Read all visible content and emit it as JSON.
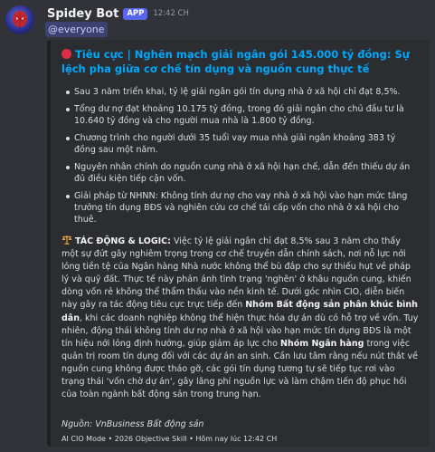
{
  "bot": {
    "name": "Spidey Bot",
    "badge": "APP",
    "timestamp": "12:42 CH",
    "mention": "@everyone"
  },
  "embed": {
    "accent_color": "#1e1f22",
    "title": "Tiêu cực | Nghẽn mạch giải ngân gói 145.000 tỷ đồng: Sự lệch pha giữa cơ chế tín dụng và nguồn cung thực tế",
    "title_icon": "red-circle-icon",
    "bullets": [
      "Sau 3 năm triển khai, tỷ lệ giải ngân gói tín dụng nhà ở xã hội chỉ đạt 8,5%.",
      "Tổng dư nợ đạt khoảng 10.175 tỷ đồng, trong đó giải ngân cho chủ đầu tư là 10.640 tỷ đồng và cho người mua nhà là 1.800 tỷ đồng.",
      "Chương trình cho người dưới 35 tuổi vay mua nhà giải ngân khoảng 383 tỷ đồng sau một năm.",
      "Nguyên nhân chính do nguồn cung nhà ở xã hội hạn chế, dẫn đến thiếu dự án đủ điều kiện tiếp cận vốn.",
      "Giải pháp từ NHNN: Không tính dư nợ cho vay nhà ở xã hội vào hạn mức tăng trưởng tín dụng BĐS và nghiên cứu cơ chế tái cấp vốn cho nhà ở xã hội cho thuê."
    ],
    "impact": {
      "icon": "balance-scale-icon",
      "label": "TÁC ĐỘNG & LOGIC:",
      "p1": " Việc tỷ lệ giải ngân chỉ đạt 8,5% sau 3 năm cho thấy một sự đứt gãy nghiêm trọng trong cơ chế truyền dẫn chính sách, nơi nỗ lực nới lỏng tiền tệ của Ngân hàng Nhà nước không thể bù đắp cho sự thiếu hụt về pháp lý và quỹ đất. Thực tế này phản ánh tình trạng 'nghẽn' ở khâu nguồn cung, khiến dòng vốn rẻ không thể thẩm thấu vào nền kinh tế. Dưới góc nhìn CIO, diễn biến này gây ra tác động tiêu cực trực tiếp đến ",
      "bold1": "Nhóm Bất động sản phân khúc bình dân",
      "p2": ", khi các doanh nghiệp không thể hiện thực hóa dự án dù có hỗ trợ về vốn. Tuy nhiên, động thái không tính dư nợ nhà ở xã hội vào hạn mức tín dụng BĐS là một tín hiệu nới lỏng định hướng, giúp giảm áp lực cho ",
      "bold2": "Nhóm Ngân hàng",
      "p3": " trong việc quản trị room tín dụng đối với các dự án an sinh. Cần lưu tâm rằng nếu nút thắt về nguồn cung không được tháo gỡ, các gói tín dụng tương tự sẽ tiếp tục rơi vào trạng thái 'vốn chờ dự án', gây lãng phí nguồn lực và làm chậm tiến độ phục hồi của toàn ngành bất động sản trong trung hạn."
    },
    "source": "Nguồn: VnBusiness Bất động sản",
    "footer": "AI CIO Mode • 2026 Objective Skill • Hôm nay lúc 12:42 CH"
  }
}
